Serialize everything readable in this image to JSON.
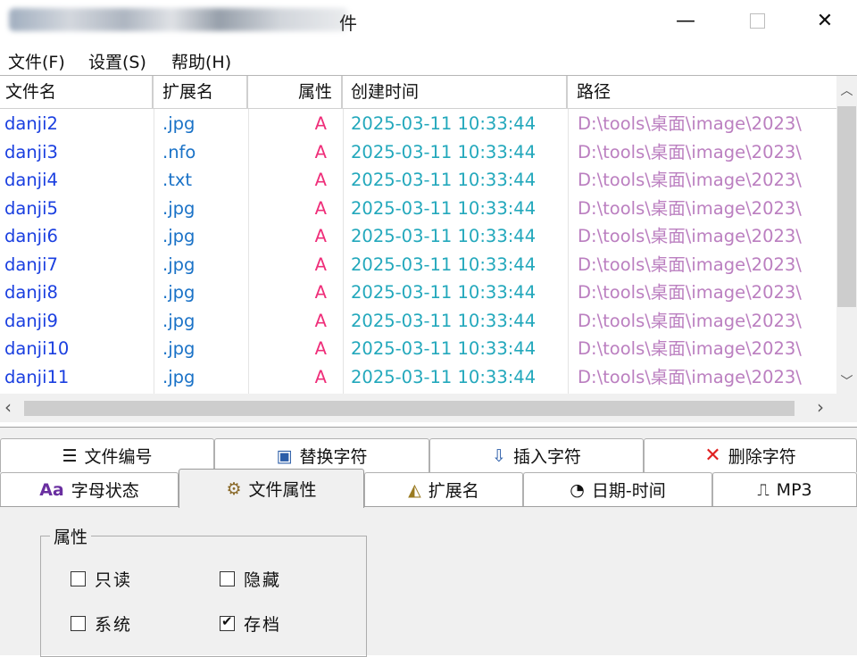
{
  "window": {
    "title_visible_char": "件",
    "minimize_glyph": "—",
    "close_glyph": "✕"
  },
  "menu": [
    "文件(F)",
    "设置(S)",
    "帮助(H)"
  ],
  "columns": [
    "文件名",
    "扩展名",
    "属性",
    "创建时间",
    "路径"
  ],
  "rows": [
    {
      "name": "danji2",
      "ext": ".jpg",
      "attr": "A",
      "time": "2025-03-11 10:33:44",
      "path": "D:\\tools\\桌面\\image\\2023\\"
    },
    {
      "name": "danji3",
      "ext": ".nfo",
      "attr": "A",
      "time": "2025-03-11 10:33:44",
      "path": "D:\\tools\\桌面\\image\\2023\\"
    },
    {
      "name": "danji4",
      "ext": ".txt",
      "attr": "A",
      "time": "2025-03-11 10:33:44",
      "path": "D:\\tools\\桌面\\image\\2023\\"
    },
    {
      "name": "danji5",
      "ext": ".jpg",
      "attr": "A",
      "time": "2025-03-11 10:33:44",
      "path": "D:\\tools\\桌面\\image\\2023\\"
    },
    {
      "name": "danji6",
      "ext": ".jpg",
      "attr": "A",
      "time": "2025-03-11 10:33:44",
      "path": "D:\\tools\\桌面\\image\\2023\\"
    },
    {
      "name": "danji7",
      "ext": ".jpg",
      "attr": "A",
      "time": "2025-03-11 10:33:44",
      "path": "D:\\tools\\桌面\\image\\2023\\"
    },
    {
      "name": "danji8",
      "ext": ".jpg",
      "attr": "A",
      "time": "2025-03-11 10:33:44",
      "path": "D:\\tools\\桌面\\image\\2023\\"
    },
    {
      "name": "danji9",
      "ext": ".jpg",
      "attr": "A",
      "time": "2025-03-11 10:33:44",
      "path": "D:\\tools\\桌面\\image\\2023\\"
    },
    {
      "name": "danji10",
      "ext": ".jpg",
      "attr": "A",
      "time": "2025-03-11 10:33:44",
      "path": "D:\\tools\\桌面\\image\\2023\\"
    },
    {
      "name": "danji11",
      "ext": ".jpg",
      "attr": "A",
      "time": "2025-03-11 10:33:44",
      "path": "D:\\tools\\桌面\\image\\2023\\"
    }
  ],
  "tabs_row1": [
    {
      "label": "文件编号",
      "icon": "list-numbered-icon"
    },
    {
      "label": "替换字符",
      "icon": "replace-icon"
    },
    {
      "label": "插入字符",
      "icon": "insert-icon"
    },
    {
      "label": "删除字符",
      "icon": "delete-x-icon"
    }
  ],
  "tabs_row2": [
    {
      "label": "字母状态",
      "icon": "letter-case-icon"
    },
    {
      "label": "文件属性",
      "icon": "gears-icon",
      "active": true
    },
    {
      "label": "扩展名",
      "icon": "extension-icon"
    },
    {
      "label": "日期-时间",
      "icon": "clock-icon"
    },
    {
      "label": "MP3",
      "icon": "mp3-file-icon"
    }
  ],
  "attributes": {
    "group_title": "属性",
    "readonly": {
      "label": "只读",
      "checked": false
    },
    "hidden": {
      "label": "隐藏",
      "checked": false
    },
    "system": {
      "label": "系统",
      "checked": false
    },
    "archive": {
      "label": "存档",
      "checked": true
    }
  },
  "colors": {
    "name": "#1a3fe0",
    "ext": "#1a72c7",
    "attr": "#ef2f7a",
    "time": "#23a8bc",
    "path": "#bb7fc0",
    "delete_icon": "#e02020"
  }
}
